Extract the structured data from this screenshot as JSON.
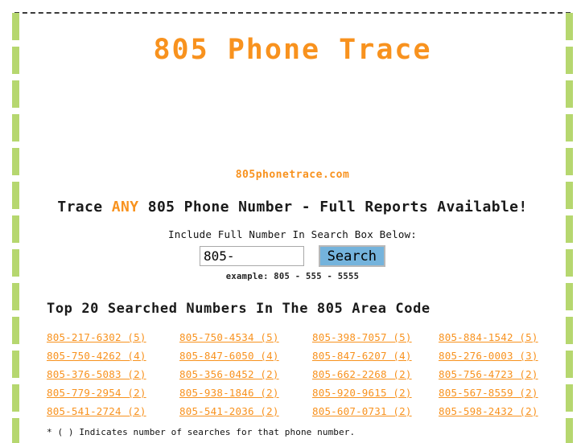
{
  "site": {
    "title": "805 Phone Trace",
    "domain": "805phonetrace.com",
    "accent_color": "#f8921e",
    "rail_color": "#b6d76f",
    "button_color": "#74b3dc"
  },
  "tagline": {
    "before": "Trace ",
    "highlight": "ANY",
    "after": " 805 Phone Number - Full Reports Available!"
  },
  "search": {
    "hint": "Include Full Number In Search Box Below:",
    "value": "805-",
    "placeholder": "805-",
    "button_label": "Search",
    "example": "example: 805 - 555 - 5555"
  },
  "top_numbers": {
    "heading": "Top 20 Searched Numbers In The 805 Area Code",
    "footnote": "* ( ) Indicates number of searches for that phone number.",
    "items": [
      "805-217-6302 (5)",
      "805-750-4534 (5)",
      "805-398-7057 (5)",
      "805-884-1542 (5)",
      "805-750-4262 (4)",
      "805-847-6050 (4)",
      "805-847-6207 (4)",
      "805-276-0003 (3)",
      "805-376-5083 (2)",
      "805-356-0452 (2)",
      "805-662-2268 (2)",
      "805-756-4723 (2)",
      "805-779-2954 (2)",
      "805-938-1846 (2)",
      "805-920-9615 (2)",
      "805-567-8559 (2)",
      "805-541-2724 (2)",
      "805-541-2036 (2)",
      "805-607-0731 (2)",
      "805-598-2432 (2)"
    ]
  }
}
